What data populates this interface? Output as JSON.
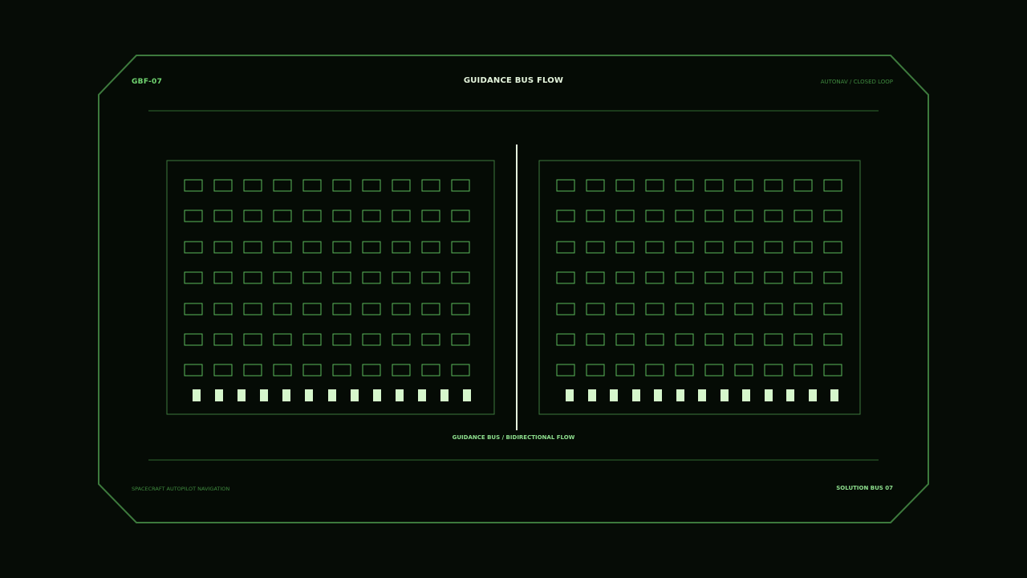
{
  "header": {
    "code": "GBF-07",
    "title": "GUIDANCE BUS FLOW",
    "mode": "AUTONAV / CLOSED LOOP"
  },
  "bus": {
    "label": "GUIDANCE BUS / BIDIRECTIONAL FLOW"
  },
  "footer": {
    "system": "SPACECRAFT AUTOPILOT NAVIGATION",
    "solution": "SOLUTION BUS 07"
  },
  "panels": [
    {
      "name": "left-register-bank",
      "rows": 7,
      "cols": 10,
      "indicators": 13
    },
    {
      "name": "right-register-bank",
      "rows": 7,
      "cols": 10,
      "indicators": 13
    }
  ],
  "colors": {
    "background": "#060c06",
    "frame": "#3d7a3d",
    "cell": "#5cb85c",
    "indicator": "#d6f7cc",
    "bus": "#e6f7de",
    "accent": "#72d872"
  }
}
